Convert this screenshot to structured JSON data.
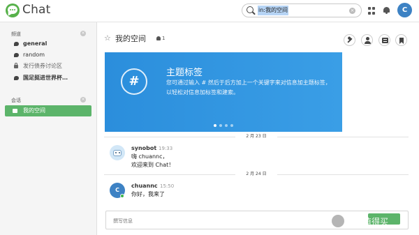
{
  "app": {
    "name": "Chat"
  },
  "search": {
    "query": "in:我的空间"
  },
  "user": {
    "avatar_letter": "C"
  },
  "sidebar": {
    "channels_title": "频道",
    "channels": [
      {
        "label": "general",
        "icon": "chat-bubble-icon",
        "bold": true
      },
      {
        "label": "random",
        "icon": "chat-bubble-icon",
        "bold": false
      },
      {
        "label": "发行债券讨论区",
        "icon": "lock-icon",
        "bold": false
      },
      {
        "label": "国足挺进世界杯…",
        "icon": "chat-bubble-icon",
        "bold": true
      }
    ],
    "conversations_title": "会话",
    "conversations": [
      {
        "label": "我的空间",
        "icon": "home-icon",
        "active": true
      }
    ]
  },
  "room": {
    "title": "我的空间",
    "member_count": "1",
    "header_actions": [
      "wrench-icon",
      "user-icon",
      "list-icon",
      "bookmark-icon"
    ]
  },
  "banner": {
    "symbol": "#",
    "title": "主题标签",
    "description": "您可通过输入 # 然后于后方加上一个关键字来对信息加主题标签，以轻松对信息加标签和建索。",
    "dot_count": 4,
    "active_dot": 0
  },
  "messages": [
    {
      "date": "2 月 23 日",
      "author": "synobot",
      "time": "19:33",
      "lines": [
        "嗨 chuannc，",
        "欢迎来到 Chat！"
      ],
      "avatar": "robot-avatar"
    },
    {
      "date": "2 月 24 日",
      "author": "chuannc",
      "time": "15:50",
      "lines": [
        "你好，我来了"
      ],
      "avatar_letter": "C"
    }
  ],
  "composer": {
    "placeholder": "撰写信息"
  },
  "watermark": {
    "text": "什么值得买"
  },
  "colors": {
    "accent": "#5cb46a",
    "banner": "#3097e0",
    "avatar": "#3d82c4"
  }
}
